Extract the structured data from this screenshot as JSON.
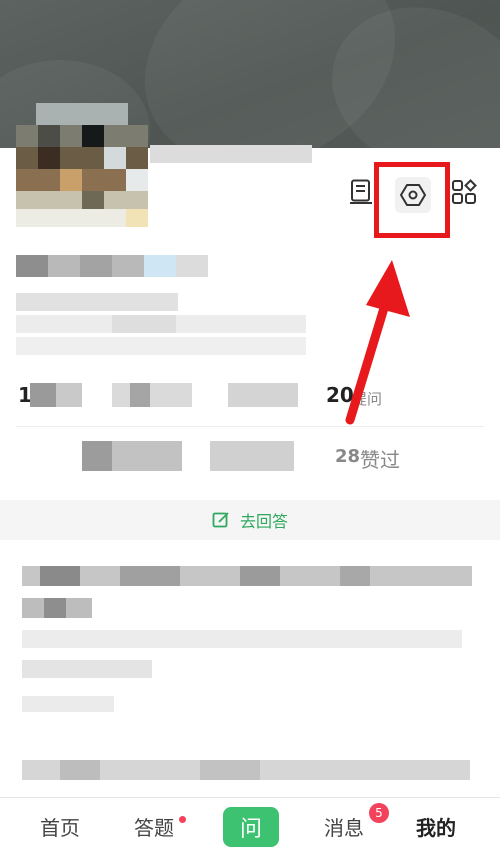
{
  "stats": {
    "first_number": "1",
    "asks_number": "20",
    "asks_label": "提问",
    "likes_number": "28",
    "likes_label": "赞过"
  },
  "answer_link": {
    "label": "去回答"
  },
  "bottom_nav": {
    "home": "首页",
    "answer": "答题",
    "ask": "问",
    "messages": "消息",
    "messages_badge": "5",
    "mine": "我的"
  },
  "icons": {
    "notes": "document-icon",
    "settings": "hexagon-settings-icon",
    "apps": "grid-icon"
  },
  "colors": {
    "accent_green": "#3cc271",
    "highlight_red": "#e8191c",
    "badge_red": "#f2425c"
  },
  "annotation": {
    "type": "red-arrow-and-box",
    "target": "settings"
  }
}
